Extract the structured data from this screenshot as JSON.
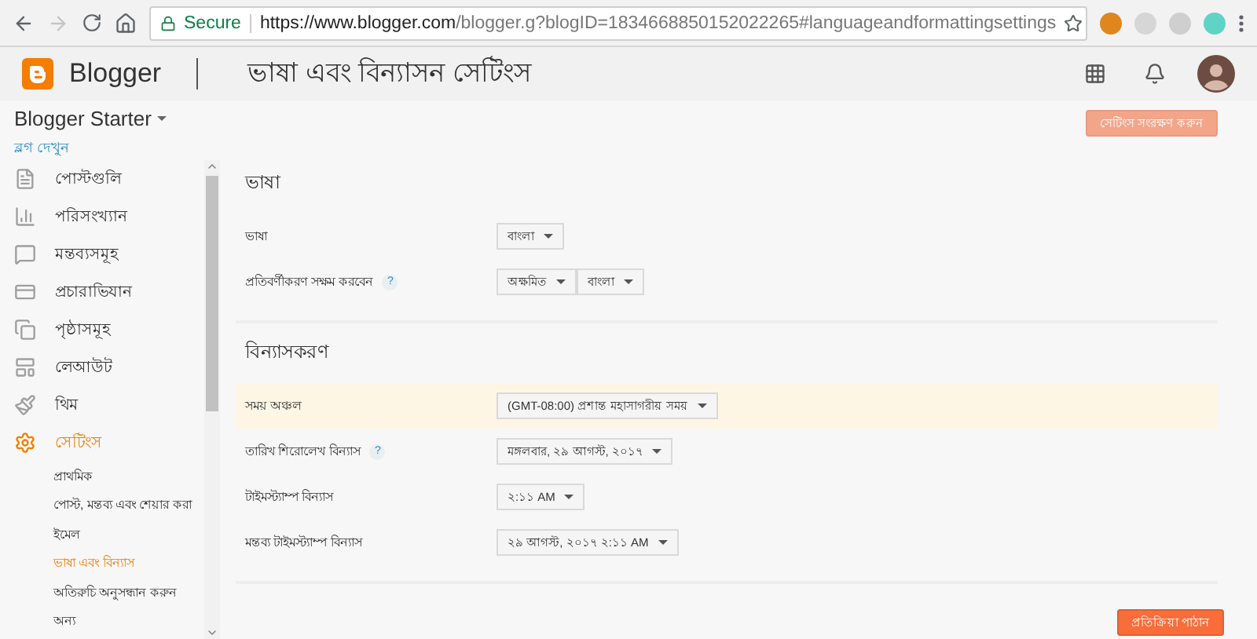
{
  "browser": {
    "secure_label": "Secure",
    "url_host": "https://www.blogger.com",
    "url_path": "/blogger.g?blogID=1834668850152022265#languageandformattingsettings"
  },
  "header": {
    "brand": "Blogger",
    "title": "ভাষা এবং বিন্যাসন সেটিংস"
  },
  "sidebar": {
    "blog_name": "Blogger Starter",
    "view_blog": "ব্লগ দেখুন",
    "items": [
      {
        "kind": "posts",
        "label": "পোস্টগুলি",
        "selected": false
      },
      {
        "kind": "stats",
        "label": "পরিসংখ্যান",
        "selected": false
      },
      {
        "kind": "comments",
        "label": "মন্তব্যসমূহ",
        "selected": false
      },
      {
        "kind": "campaigns",
        "label": "প্রচারাভিযান",
        "selected": false
      },
      {
        "kind": "pages",
        "label": "পৃষ্ঠাসমূহ",
        "selected": false
      },
      {
        "kind": "layout",
        "label": "লেআউট",
        "selected": false
      },
      {
        "kind": "theme",
        "label": "থিম",
        "selected": false
      },
      {
        "kind": "settings",
        "label": "সেটিংস",
        "selected": true,
        "children": [
          {
            "label": "প্রাথমিক",
            "selected": false
          },
          {
            "label": "পোস্ট, মন্তব্য এবং শেয়ার করা",
            "selected": false
          },
          {
            "label": "ইমেল",
            "selected": false
          },
          {
            "label": "ভাষা এবং বিন্যাস",
            "selected": true
          },
          {
            "label": "অতিরুচি অনুসন্ধান করুন",
            "selected": false
          },
          {
            "label": "অন্য",
            "selected": false
          }
        ]
      }
    ]
  },
  "save_button": "সেটিংস সংরক্ষণ করুন",
  "sections": [
    {
      "title": "ভাষা",
      "rows": [
        {
          "label": "ভাষা",
          "help": false,
          "highlighted": false,
          "selects": [
            "বাংলা"
          ]
        },
        {
          "label": "প্রতিবর্ণীকরণ সক্ষম করবেন",
          "help": true,
          "highlighted": false,
          "selects": [
            "অক্ষমিত",
            "বাংলা"
          ]
        }
      ]
    },
    {
      "title": "বিন্যাসকরণ",
      "rows": [
        {
          "label": "সময় অঞ্চল",
          "help": false,
          "highlighted": true,
          "selects": [
            "(GMT-08:00) প্রশান্ত মহাসাগরীয় সময়"
          ]
        },
        {
          "label": "তারিখ শিরোলেখ বিন্যাস",
          "help": true,
          "highlighted": false,
          "selects": [
            "মঙ্গলবার, ২৯ আগস্ট, ২০১৭"
          ]
        },
        {
          "label": "টাইমস্ট্যাম্প বিন্যাস",
          "help": false,
          "highlighted": false,
          "selects": [
            "২:১১ AM"
          ]
        },
        {
          "label": "মন্তব্য টাইমস্ট্যাম্প বিন্যাস",
          "help": false,
          "highlighted": false,
          "selects": [
            "২৯ আগস্ট, ২০১৭ ২:১১ AM"
          ]
        }
      ]
    }
  ],
  "help_mark": "?",
  "feedback_button": "প্রতিক্রিয়া পাঠান"
}
